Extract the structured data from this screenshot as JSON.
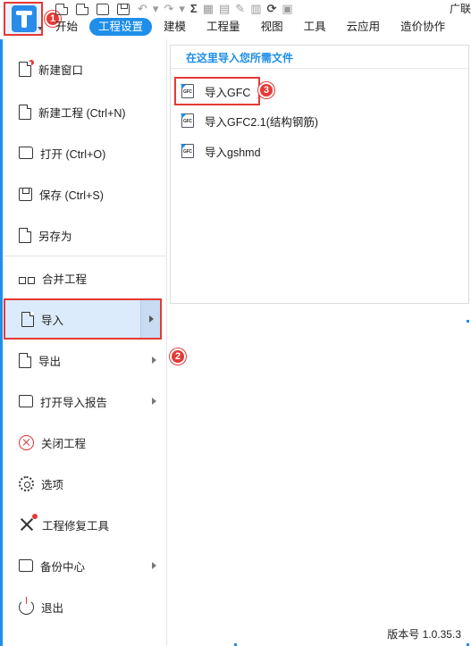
{
  "brand_text": "广联",
  "tabs": [
    {
      "label": "开始",
      "active": false
    },
    {
      "label": "工程设置",
      "active": true
    },
    {
      "label": "建模",
      "active": false
    },
    {
      "label": "工程量",
      "active": false
    },
    {
      "label": "视图",
      "active": false
    },
    {
      "label": "工具",
      "active": false
    },
    {
      "label": "云应用",
      "active": false
    },
    {
      "label": "造价协作",
      "active": false
    }
  ],
  "badges": {
    "one": "1",
    "two": "2",
    "three": "3"
  },
  "menu": {
    "items": [
      {
        "label": "新建窗口",
        "icon": "new-window-icon",
        "has_arrow": false
      },
      {
        "label": "新建工程 (Ctrl+N)",
        "icon": "new-project-icon",
        "has_arrow": false
      },
      {
        "label": "打开 (Ctrl+O)",
        "icon": "folder-open-icon",
        "has_arrow": false
      },
      {
        "label": "保存 (Ctrl+S)",
        "icon": "save-icon",
        "has_arrow": false
      },
      {
        "label": "另存为",
        "icon": "save-as-icon",
        "has_arrow": false
      },
      {
        "label": "合并工程",
        "icon": "merge-icon",
        "has_arrow": false
      },
      {
        "label": "导入",
        "icon": "import-icon",
        "has_arrow": true,
        "active": true
      },
      {
        "label": "导出",
        "icon": "export-icon",
        "has_arrow": true
      },
      {
        "label": "打开导入报告",
        "icon": "import-report-icon",
        "has_arrow": true
      },
      {
        "label": "关闭工程",
        "icon": "close-circle-icon",
        "has_arrow": false
      },
      {
        "label": "选项",
        "icon": "gear-icon",
        "has_arrow": false
      },
      {
        "label": "工程修复工具",
        "icon": "repair-tool-icon",
        "has_arrow": false
      },
      {
        "label": "备份中心",
        "icon": "backup-icon",
        "has_arrow": true
      },
      {
        "label": "退出",
        "icon": "power-icon",
        "has_arrow": false
      }
    ]
  },
  "submenu": {
    "header": "在这里导入您所需文件",
    "items": [
      {
        "label": "导入GFC",
        "icon_text": "GFC",
        "highlighted": true
      },
      {
        "label": "导入GFC2.1(结构钢筋)",
        "icon_text": "GFC",
        "highlighted": false
      },
      {
        "label": "导入gshmd",
        "icon_text": "GFC",
        "highlighted": false
      }
    ]
  },
  "footer": {
    "version": "版本号 1.0.35.3"
  },
  "colors": {
    "accent": "#1e8ee9",
    "highlight": "#e53935",
    "active_bg": "#dcebfb"
  }
}
